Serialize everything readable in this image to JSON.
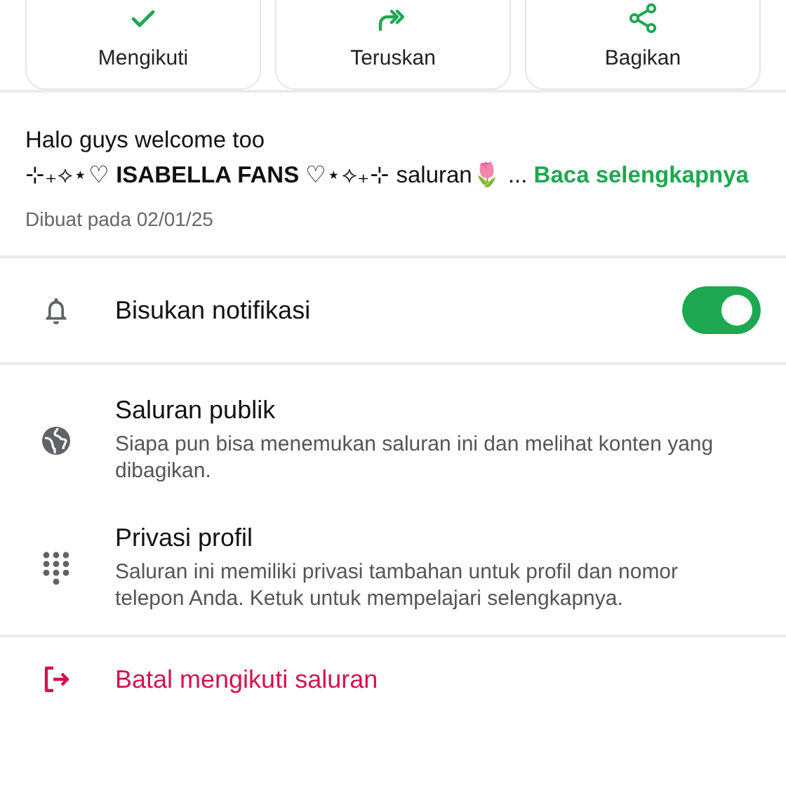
{
  "actions": [
    {
      "kind": "check",
      "label": "Mengikuti"
    },
    {
      "kind": "forward",
      "label": "Teruskan"
    },
    {
      "kind": "share",
      "label": "Bagikan"
    }
  ],
  "description": {
    "text": "Halo guys welcome too\n⊹₊⟡⋆♡ **ISABELLA FANS** ♡⋆⟡₊⊹ saluran🌷 ...",
    "link": "Baca selengkapnya",
    "created": "Dibuat pada 02/01/25"
  },
  "mute": {
    "label": "Bisukan notifikasi",
    "on": true
  },
  "settings": [
    {
      "kind": "globe",
      "title": "Saluran publik",
      "detail": "Siapa pun bisa menemukan saluran ini dan melihat konten yang dibagikan."
    },
    {
      "kind": "dialpad",
      "title": "Privasi profil",
      "detail": "Saluran ini memiliki privasi tambahan untuk profil dan nomor telepon Anda. Ketuk untuk mempelajari selengkapnya."
    }
  ],
  "unfollow": {
    "label": "Batal mengikuti saluran"
  }
}
